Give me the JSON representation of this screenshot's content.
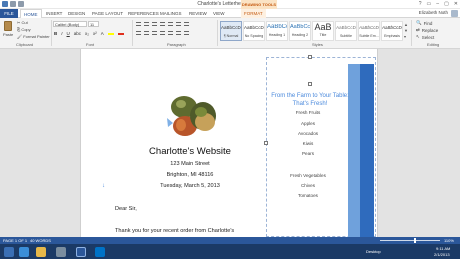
{
  "window": {
    "title": "Charlotte's Letterhead - Word",
    "context_label": "DRAWING TOOLS",
    "controls": [
      "?",
      "▭",
      "–",
      "▢",
      "✕"
    ]
  },
  "tabs": {
    "file": "FILE",
    "items": [
      "HOME",
      "INSERT",
      "DESIGN",
      "PAGE LAYOUT",
      "REFERENCES",
      "MAILINGS",
      "REVIEW",
      "VIEW",
      "FORMAT"
    ],
    "active": "HOME"
  },
  "user": {
    "name": "Elizabeth Noth"
  },
  "ribbon": {
    "clipboard": {
      "paste": "Paste",
      "cut": "Cut",
      "copy": "Copy",
      "format_painter": "Format Painter",
      "label": "Clipboard"
    },
    "font": {
      "name": "Calibri (Body)",
      "size": "11",
      "label": "Font",
      "bold": "B",
      "italic": "I",
      "underline": "U"
    },
    "paragraph": {
      "label": "Paragraph"
    },
    "styles": {
      "label": "Styles",
      "items": [
        {
          "preview": "AaBbCcDc",
          "name": "¶ Normal"
        },
        {
          "preview": "AaBbCcDc",
          "name": "No Spacing"
        },
        {
          "preview": "AaBbCc",
          "name": "Heading 1"
        },
        {
          "preview": "AaBbCcC",
          "name": "Heading 2"
        },
        {
          "preview": "AaB",
          "name": "Title"
        },
        {
          "preview": "AaBbCcD",
          "name": "Subtitle"
        },
        {
          "preview": "AaBbCcDc",
          "name": "Subtle Em..."
        },
        {
          "preview": "AaBbCcDc",
          "name": "Emphasis"
        }
      ]
    },
    "editing": {
      "find": "Find",
      "replace": "Replace",
      "select": "Select",
      "label": "Editing"
    }
  },
  "sidebar": {
    "title": "From the Farm to Your Table: That's Fresh!",
    "fruits_heading": "Fresh Fruits",
    "fruits": [
      "Apples",
      "Avocados",
      "Kiwis",
      "Pears"
    ],
    "veg_heading": "Fresh Vegetables",
    "vegetables": [
      "Chives",
      "Tomatoes"
    ]
  },
  "letter": {
    "title": "Charlotte's Website",
    "address1": "123 Main Street",
    "address2": "Brighton, MI 48116",
    "date": "Tuesday, March 5, 2013",
    "salutation": "Dear Sir,",
    "body": "Thank you for your recent order from Charlotte's"
  },
  "status": {
    "page": "PAGE 1 OF 1",
    "words": "40 WORDS",
    "zoom": "110%"
  },
  "taskbar": {
    "desktop": "Desktop",
    "time": "9:11 AM",
    "date": "2/1/2013"
  }
}
